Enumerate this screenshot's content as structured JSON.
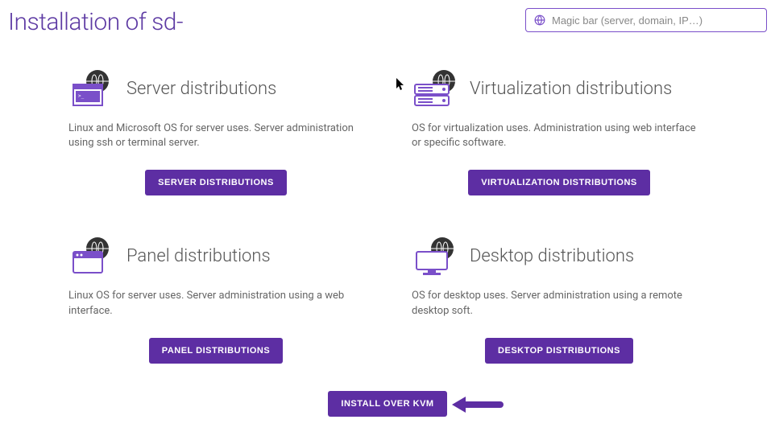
{
  "header": {
    "title": "Installation of sd-",
    "search_placeholder": "Magic bar (server, domain, IP…)"
  },
  "cards": {
    "server": {
      "title": "Server distributions",
      "desc": "Linux and Microsoft OS for server uses. Server administration using ssh or terminal server.",
      "button": "SERVER DISTRIBUTIONS"
    },
    "virtualization": {
      "title": "Virtualization distributions",
      "desc": "OS for virtualization uses. Administration using web interface or specific software.",
      "button": "VIRTUALIZATION DISTRIBUTIONS"
    },
    "panel": {
      "title": "Panel distributions",
      "desc": "Linux OS for server uses. Server administration using a web interface.",
      "button": "PANEL DISTRIBUTIONS"
    },
    "desktop": {
      "title": "Desktop distributions",
      "desc": "OS for desktop uses. Server administration using a remote desktop soft.",
      "button": "DESKTOP DISTRIBUTIONS"
    }
  },
  "footer": {
    "install_button": "INSTALL OVER KVM"
  },
  "colors": {
    "accent": "#5d2ea3",
    "title": "#5d3aa3"
  }
}
